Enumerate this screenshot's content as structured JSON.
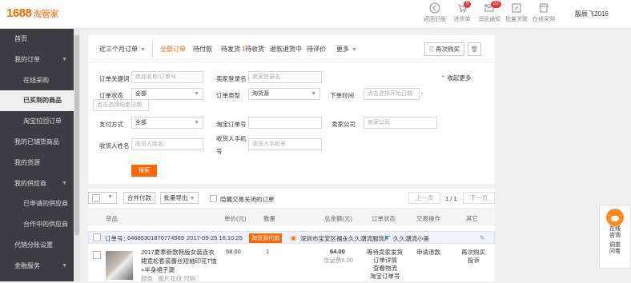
{
  "header": {
    "logo_main": "1688",
    "logo_sub": "淘管家",
    "icons": [
      {
        "name": "返回旧版",
        "icon": "back-circle-icon",
        "badge": ""
      },
      {
        "name": "进货单",
        "icon": "cart-icon",
        "badge": "9"
      },
      {
        "name": "消息通知",
        "icon": "mail-icon",
        "badge": "22"
      },
      {
        "name": "批量关联",
        "icon": "link-icon",
        "badge": ""
      },
      {
        "name": "在线采购",
        "icon": "shop-icon",
        "badge": ""
      }
    ],
    "user": "殷辰飞2016"
  },
  "sidebar": {
    "items": [
      {
        "label": "首页",
        "type": "top",
        "active": false
      },
      {
        "label": "我的订单",
        "type": "top",
        "active": false
      },
      {
        "label": "在线采购",
        "type": "sub",
        "active": false
      },
      {
        "label": "已买到的商品",
        "type": "sub",
        "active": true
      },
      {
        "label": "淘宝拉回订单",
        "type": "sub",
        "active": false
      },
      {
        "label": "我的已铺货商品",
        "type": "top",
        "active": false
      },
      {
        "label": "我的货源",
        "type": "top",
        "active": false
      },
      {
        "label": "我的供应商",
        "type": "top",
        "active": false
      },
      {
        "label": "已申请的供应商",
        "type": "sub",
        "active": false
      },
      {
        "label": "合作中的供应商",
        "type": "sub",
        "active": false
      },
      {
        "label": "代销分账设置",
        "type": "top",
        "active": false
      },
      {
        "label": "金融服务",
        "type": "top",
        "active": false
      }
    ]
  },
  "tabs": {
    "period": "近三个月订单",
    "items": [
      "全部订单",
      "待付款",
      "待发货",
      "待收货",
      "退款退货中",
      "待评价",
      "更多"
    ],
    "pending_ship_count": "1",
    "rebuy": "再次购买"
  },
  "filters": {
    "keyword_label": "订单关键词",
    "keyword_ph": "商品名称/订单号",
    "seller_login_label": "卖家登录名",
    "seller_login_ph": "卖家登录名",
    "collapse": "收起更多",
    "status_label": "订单状态",
    "status_value": "全部",
    "type_label": "订单类型",
    "type_value": "淘货源",
    "time_label": "下单时间",
    "start_ph": "点击选择开始日期",
    "end_ph": "点击选择结束日期",
    "dash": "-",
    "pay_label": "支付方式",
    "pay_value": "全部",
    "taobao_no_label": "淘宝订单号",
    "company_label": "卖家公司",
    "company_ph": "卖家公司",
    "receiver_label": "收货人姓名",
    "receiver_ph": "收货人姓名",
    "phone_label_1": "收货人手机",
    "phone_label_2": "号",
    "phone_ph": "收货人手机号",
    "search": "搜索"
  },
  "list": {
    "merge_pay": "合并付款",
    "batch_export": "批量导出",
    "hide_closed": "隐藏交易关闭的订单",
    "prev": "上一页",
    "page": "1 / 1",
    "next": "下一页",
    "headers": [
      "货品",
      "单价(元)",
      "数量",
      "总金额(元)",
      "订单状态",
      "交易操作",
      "其它"
    ]
  },
  "order": {
    "no_label": "订单号：",
    "no": "64685301876774569",
    "time": "2017-09-25 16:10:25",
    "tag": "淘货源代销",
    "seller": "深圳市宝安区福永久久潮流服饰厂",
    "shop": "久久潮流小美",
    "title_line1": "2017夏季新款韩版女装连衣",
    "title_line2": "裙宽松套装蕾丝短袖印花T恤",
    "title_line3": "+半身裙子潮",
    "title_line4": "颜色 : 图片花纹 尺码 :",
    "price": "58.00",
    "qty": "1",
    "total": "64.00",
    "shipping": "含运费6.00",
    "status_1": "等待卖家发货",
    "status_2": "订单详情",
    "status_3": "查看物流",
    "status_4": "淘宝订单号",
    "op": "申请退款",
    "other_1": "再次购买",
    "other_2": "投诉"
  },
  "side_widget": {
    "line1": "在线",
    "line2": "咨询",
    "line3": "调查",
    "line4": "问卷"
  }
}
